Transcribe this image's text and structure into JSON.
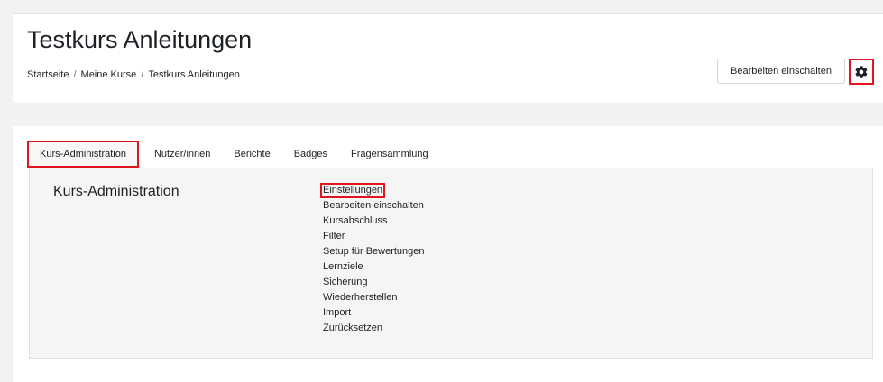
{
  "header": {
    "title": "Testkurs Anleitungen",
    "breadcrumb": [
      "Startseite",
      "Meine Kurse",
      "Testkurs Anleitungen"
    ],
    "breadcrumb_separator": "/",
    "edit_button_label": "Bearbeiten einschalten",
    "gear_icon": "gear-icon"
  },
  "tabs": [
    {
      "label": "Kurs-Administration",
      "active": true
    },
    {
      "label": "Nutzer/innen",
      "active": false
    },
    {
      "label": "Berichte",
      "active": false
    },
    {
      "label": "Badges",
      "active": false
    },
    {
      "label": "Fragensammlung",
      "active": false
    }
  ],
  "admin": {
    "section_title": "Kurs-Administration",
    "links": [
      "Einstellungen",
      "Bearbeiten einschalten",
      "Kursabschluss",
      "Filter",
      "Setup für Bewertungen",
      "Lernziele",
      "Sicherung",
      "Wiederherstellen",
      "Import",
      "Zurücksetzen"
    ]
  },
  "colors": {
    "highlight": "#e0161f",
    "panel_bg": "#f5f5f5",
    "text": "#1d2125"
  }
}
